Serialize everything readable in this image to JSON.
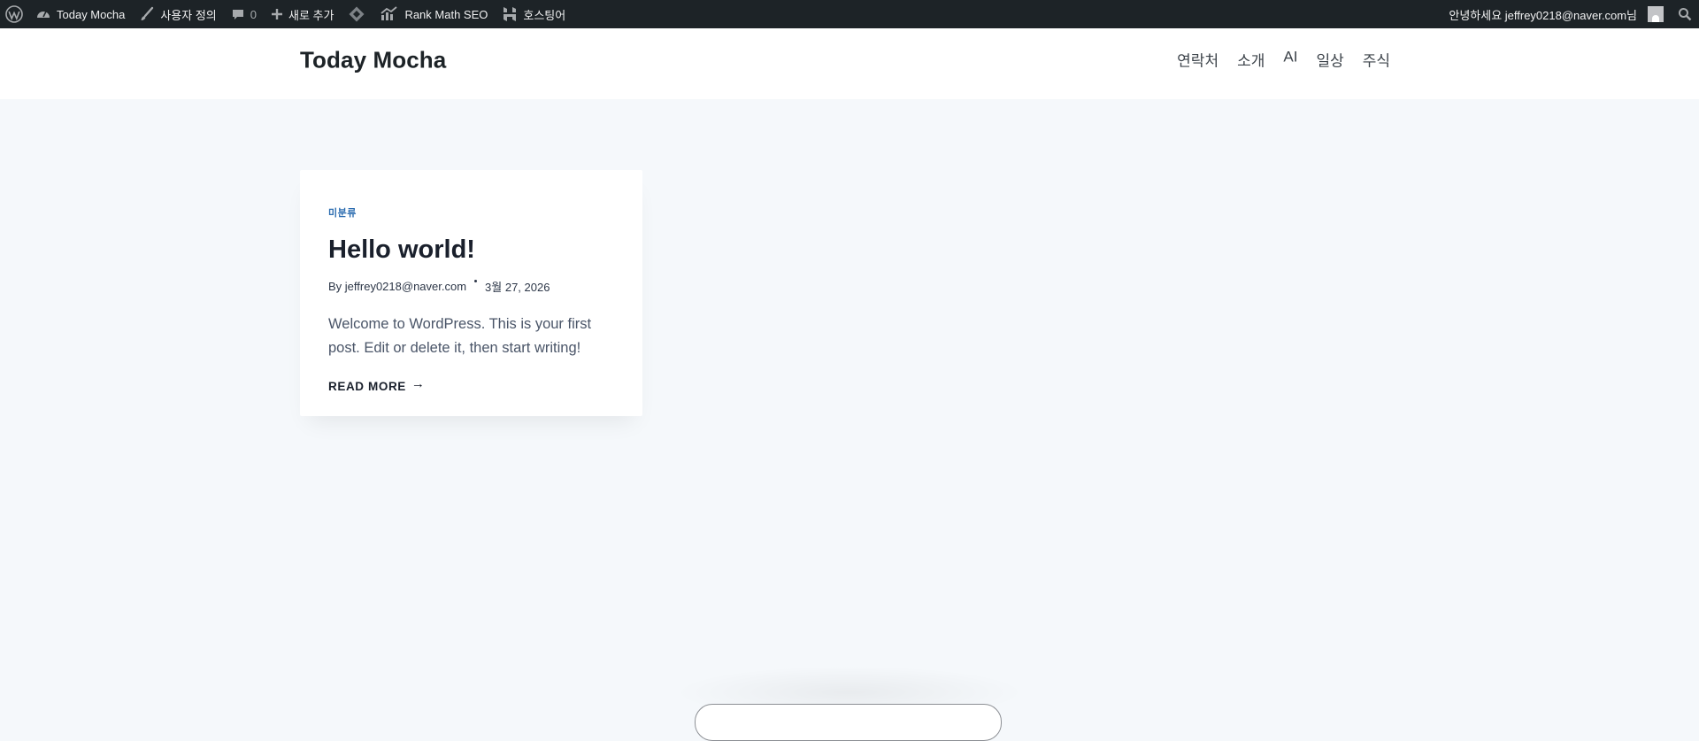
{
  "adminbar": {
    "site_name": "Today Mocha",
    "customize": "사용자 정의",
    "comments_count": "0",
    "new": "새로 추가",
    "rank_math": "Rank Math SEO",
    "hosting": "호스팅어",
    "greeting": "안녕하세요 jeffrey0218@naver.com님"
  },
  "site": {
    "title": "Today Mocha",
    "nav": [
      "연락처",
      "소개",
      "AI",
      "일상",
      "주식"
    ]
  },
  "post": {
    "category": "미분류",
    "title": "Hello world!",
    "author_line": "By jeffrey0218@naver.com",
    "date": "3월 27, 2026",
    "excerpt": "Welcome to WordPress. This is your first post. Edit or delete it, then start writing!",
    "read_more": "READ MORE",
    "read_more_arrow": "→"
  },
  "colors": {
    "adminbar_bg": "#1d2327",
    "page_bg": "#f5f8fb",
    "category": "#2b6cb0"
  }
}
